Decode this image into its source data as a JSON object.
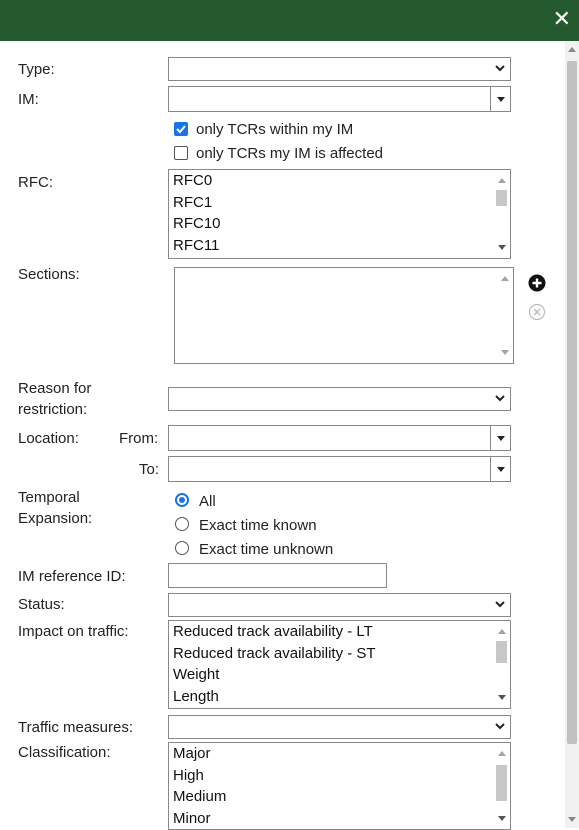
{
  "header": {
    "close_label": "✕"
  },
  "form": {
    "type": {
      "label": "Type:",
      "value": ""
    },
    "im": {
      "label": "IM:",
      "value": ""
    },
    "checkboxes": [
      {
        "label": "only TCRs within my IM",
        "checked": true
      },
      {
        "label": "only TCRs my IM is affected",
        "checked": false
      }
    ],
    "rfc": {
      "label": "RFC:",
      "items": [
        "RFC0",
        "RFC1",
        "RFC10",
        "RFC11"
      ]
    },
    "sections": {
      "label": "Sections:"
    },
    "reason": {
      "label_line1": "Reason for",
      "label_line2": "restriction:",
      "value": ""
    },
    "location": {
      "label": "Location:",
      "from_label": "From:",
      "to_label": "To:",
      "from_value": "",
      "to_value": ""
    },
    "temporal": {
      "label_line1": "Temporal",
      "label_line2": "Expansion:",
      "options": [
        {
          "label": "All",
          "selected": true
        },
        {
          "label": "Exact time known",
          "selected": false
        },
        {
          "label": "Exact time unknown",
          "selected": false
        }
      ]
    },
    "im_reference": {
      "label": "IM reference ID:",
      "value": ""
    },
    "status": {
      "label": "Status:",
      "value": ""
    },
    "impact": {
      "label": "Impact on traffic:",
      "items": [
        "Reduced track availability - LT",
        "Reduced track availability - ST",
        "Weight",
        "Length"
      ]
    },
    "traffic_measures": {
      "label": "Traffic measures:",
      "value": ""
    },
    "classification": {
      "label": "Classification:",
      "items": [
        "Major",
        "High",
        "Medium",
        "Minor"
      ]
    }
  },
  "icons": {
    "add": "plus-circle-icon",
    "remove": "x-circle-icon"
  },
  "colors": {
    "header": "#255a2e",
    "accent": "#1a73e8"
  }
}
